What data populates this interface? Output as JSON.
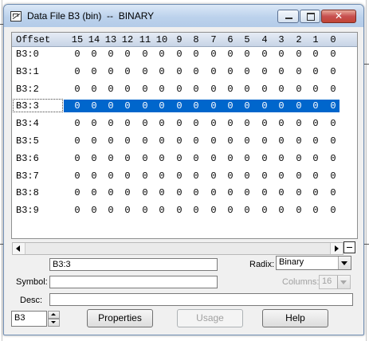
{
  "window": {
    "title": "Data File B3 (bin)  --  BINARY",
    "icon": "data-file-icon",
    "controls": {
      "minimize": "minimize-icon",
      "maximize": "maximize-icon",
      "close": "close-icon",
      "close_glyph": "✕"
    }
  },
  "grid": {
    "offset_header": "Offset",
    "bit_headers": [
      "15",
      "14",
      "13",
      "12",
      "11",
      "10",
      "9",
      "8",
      "7",
      "6",
      "5",
      "4",
      "3",
      "2",
      "1",
      "0"
    ],
    "rows": [
      {
        "offset": "B3:0",
        "bits": [
          "0",
          "0",
          "0",
          "0",
          "0",
          "0",
          "0",
          "0",
          "0",
          "0",
          "0",
          "0",
          "0",
          "0",
          "0",
          "0"
        ]
      },
      {
        "offset": "B3:1",
        "bits": [
          "0",
          "0",
          "0",
          "0",
          "0",
          "0",
          "0",
          "0",
          "0",
          "0",
          "0",
          "0",
          "0",
          "0",
          "0",
          "0"
        ]
      },
      {
        "offset": "B3:2",
        "bits": [
          "0",
          "0",
          "0",
          "0",
          "0",
          "0",
          "0",
          "0",
          "0",
          "0",
          "0",
          "0",
          "0",
          "0",
          "0",
          "0"
        ]
      },
      {
        "offset": "B3:3",
        "bits": [
          "0",
          "0",
          "0",
          "0",
          "0",
          "0",
          "0",
          "0",
          "0",
          "0",
          "0",
          "0",
          "0",
          "0",
          "0",
          "0"
        ],
        "selected": true
      },
      {
        "offset": "B3:4",
        "bits": [
          "0",
          "0",
          "0",
          "0",
          "0",
          "0",
          "0",
          "0",
          "0",
          "0",
          "0",
          "0",
          "0",
          "0",
          "0",
          "0"
        ]
      },
      {
        "offset": "B3:5",
        "bits": [
          "0",
          "0",
          "0",
          "0",
          "0",
          "0",
          "0",
          "0",
          "0",
          "0",
          "0",
          "0",
          "0",
          "0",
          "0",
          "0"
        ]
      },
      {
        "offset": "B3:6",
        "bits": [
          "0",
          "0",
          "0",
          "0",
          "0",
          "0",
          "0",
          "0",
          "0",
          "0",
          "0",
          "0",
          "0",
          "0",
          "0",
          "0"
        ]
      },
      {
        "offset": "B3:7",
        "bits": [
          "0",
          "0",
          "0",
          "0",
          "0",
          "0",
          "0",
          "0",
          "0",
          "0",
          "0",
          "0",
          "0",
          "0",
          "0",
          "0"
        ]
      },
      {
        "offset": "B3:8",
        "bits": [
          "0",
          "0",
          "0",
          "0",
          "0",
          "0",
          "0",
          "0",
          "0",
          "0",
          "0",
          "0",
          "0",
          "0",
          "0",
          "0"
        ]
      },
      {
        "offset": "B3:9",
        "bits": [
          "0",
          "0",
          "0",
          "0",
          "0",
          "0",
          "0",
          "0",
          "0",
          "0",
          "0",
          "0",
          "0",
          "0",
          "0",
          "0"
        ]
      }
    ],
    "selection_color": "#0066cc"
  },
  "form": {
    "address_value": "B3:3",
    "radix_label": "Radix:",
    "radix_value": "Binary",
    "symbol_label": "Symbol:",
    "symbol_value": "",
    "columns_label": "Columns:",
    "columns_value": "16",
    "desc_label": "Desc:",
    "desc_value": ""
  },
  "footer": {
    "file_value": "B3",
    "properties_label": "Properties",
    "usage_label": "Usage",
    "help_label": "Help"
  }
}
